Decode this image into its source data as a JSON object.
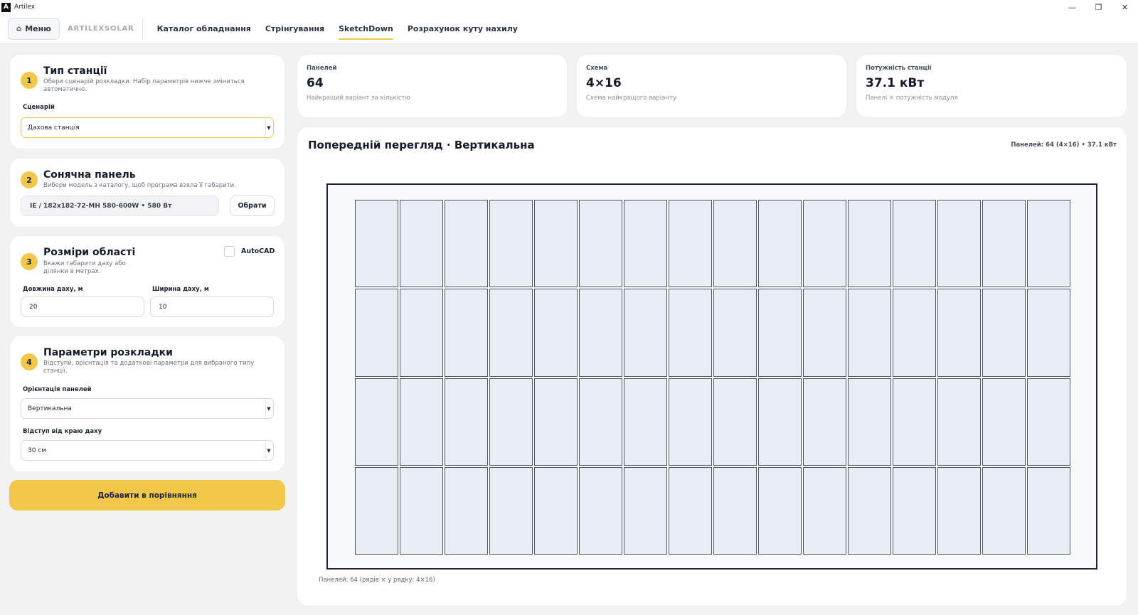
{
  "window": {
    "title": "Artilex",
    "logo_glyph": "A",
    "controls": {
      "minimize": "—",
      "maximize": "❐",
      "close": "✕"
    }
  },
  "nav": {
    "menu_label": "Меню",
    "menu_icon": "⌂",
    "brand": "ARTILEXSOLAR",
    "tabs": [
      "Каталог обладнання",
      "Стрінгування",
      "SketchDown",
      "Розрахунок куту нахилу"
    ],
    "active_tab": "SketchDown"
  },
  "step1": {
    "number": "1",
    "title": "Тип станції",
    "description": "Обери сценарій розкладки. Набір параметрів нижче зміниться автоматично.",
    "scenario_label": "Сценарій",
    "scenario_value": "Дахова станція"
  },
  "step2": {
    "number": "2",
    "title": "Сонячна панель",
    "description": "Вибери модель з каталогу, щоб програма взяла її габарити.",
    "panel_value": "IE / 182x182-72-MH 580-600W • 580 Вт",
    "choose_label": "Обрати"
  },
  "step3": {
    "number": "3",
    "title": "Розміри області",
    "description": "Вкажи габарити даху або ділянки в метрах.",
    "autocad_label": "AutoCAD",
    "autocad_checked": false,
    "length_label": "Довжина даху, м",
    "length_value": "20",
    "width_label": "Ширина даху, м",
    "width_value": "10"
  },
  "step4": {
    "number": "4",
    "title": "Параметри розкладки",
    "description": "Відступи, орієнтація та додаткові параметри для вибраного типу станції.",
    "orientation_label": "Орієнтація панелей",
    "orientation_value": "Вертикальна",
    "offset_label": "Відступ від краю даху",
    "offset_value": "30 см"
  },
  "add_button": "Добавити в порівняння",
  "stats": {
    "panels": {
      "label": "Панелей",
      "value": "64",
      "sub": "Найкращий варіант за кількістю"
    },
    "scheme": {
      "label": "Схема",
      "value": "4×16",
      "sub": "Схема найкращого варіанту"
    },
    "power": {
      "label": "Потужність станції",
      "value": "37.1 кВт",
      "sub": "Панелі × потужність модуля"
    }
  },
  "preview": {
    "title": "Попередній перегляд · Вертикальна",
    "meta": "Панелей: 64  (4×16)  •  37.1 кВт",
    "footer": "Панелей: 64  (рядів × у рядку: 4×16)",
    "rows": 4,
    "cols": 16
  }
}
